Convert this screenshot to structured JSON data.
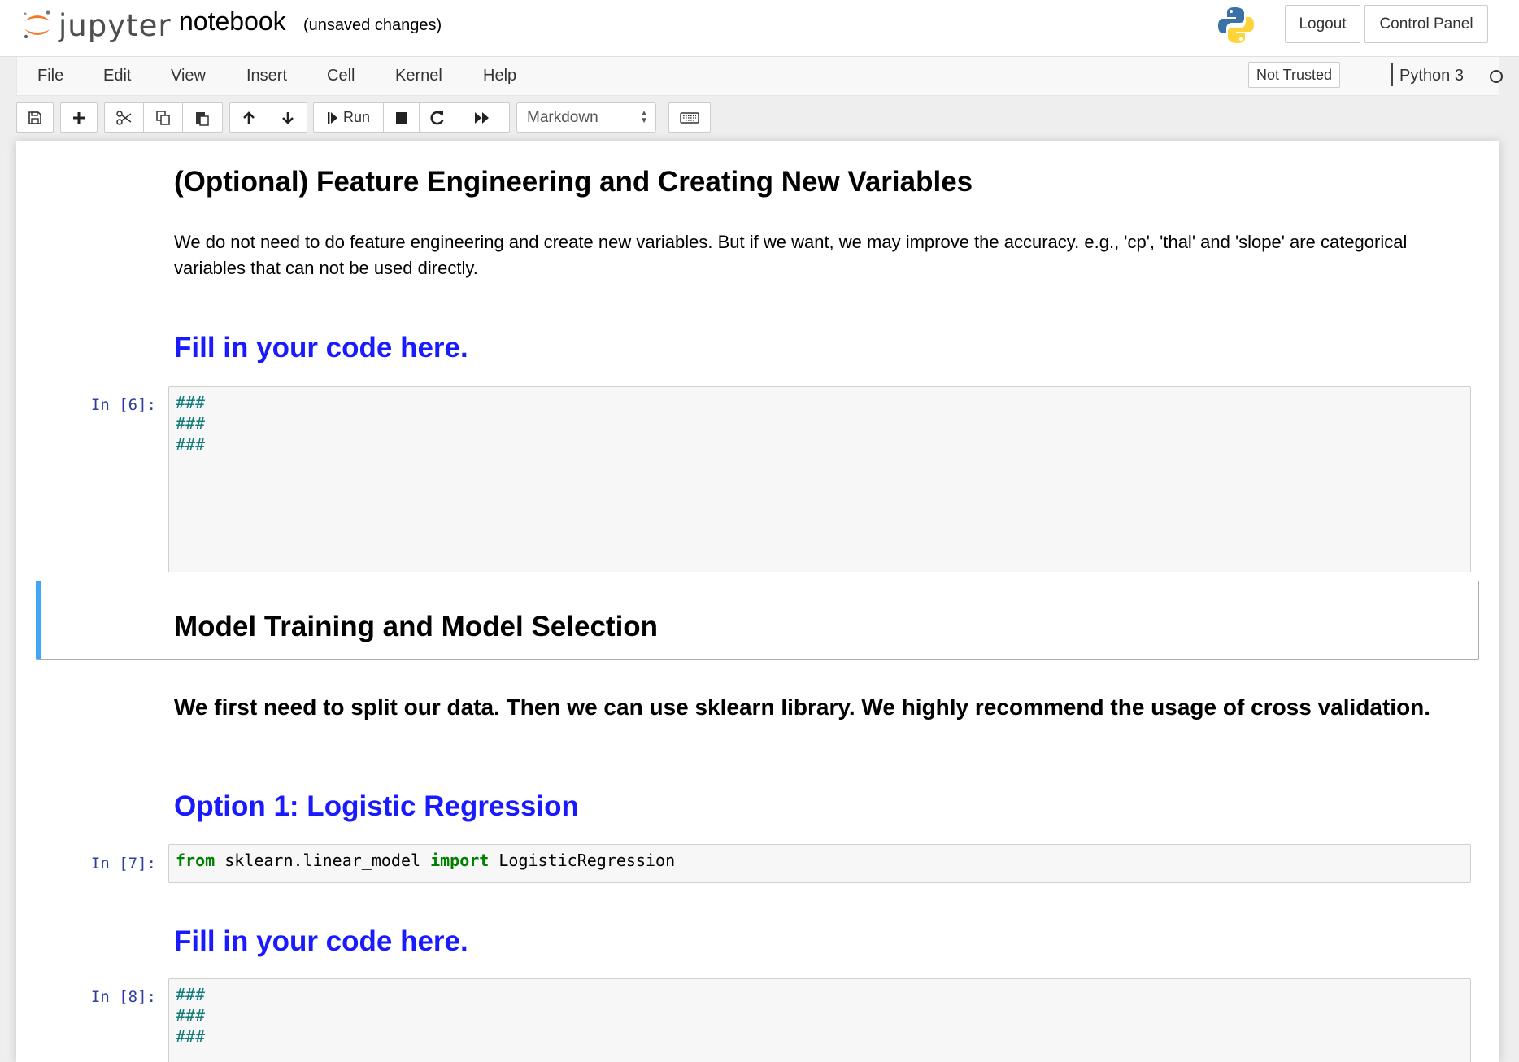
{
  "header": {
    "logo_text": "jupyter",
    "notebook_name": "notebook",
    "save_status": "(unsaved changes)",
    "logout_label": "Logout",
    "control_panel_label": "Control Panel"
  },
  "menubar": {
    "items": [
      "File",
      "Edit",
      "View",
      "Insert",
      "Cell",
      "Kernel",
      "Help"
    ],
    "trust_label": "Not Trusted",
    "kernel_name": "Python 3"
  },
  "toolbar": {
    "run_label": "Run",
    "cell_type": "Markdown"
  },
  "notebook": {
    "feature_heading": "(Optional) Feature Engineering and Creating New Variables",
    "feature_text": "We do not need to do feature engineering and create new variables. But if we want, we may improve the accuracy. e.g., 'cp', 'thal' and 'slope' are categorical variables that can not be used directly.",
    "fill_code_1": "Fill in your code here.",
    "cell6": {
      "prompt": "In [6]:",
      "lines": [
        "###",
        "###",
        "###"
      ]
    },
    "model_heading": "Model Training and Model Selection",
    "model_text": "We first need to split our data. Then we can use sklearn library. We highly recommend the usage of cross validation.",
    "option1_heading": "Option 1: Logistic Regression",
    "cell7": {
      "prompt": "In [7]:",
      "kw_from": "from",
      "module": " sklearn.linear_model ",
      "kw_import": "import",
      "name": " LogisticRegression"
    },
    "fill_code_2": "Fill in your code here.",
    "cell8": {
      "prompt": "In [8]:",
      "lines": [
        "###",
        "###",
        "###"
      ]
    }
  },
  "colors": {
    "selected_cell_border": "#42a5f5",
    "prompt_color": "#303f9f",
    "heading_blue": "#1a1aff",
    "comment_color": "#117a7a",
    "keyword_color": "#008000"
  }
}
